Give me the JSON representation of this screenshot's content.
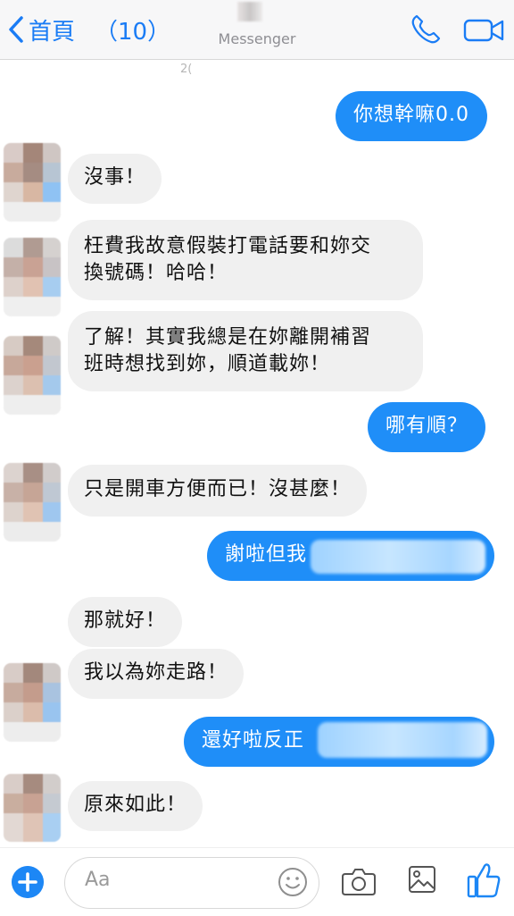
{
  "header": {
    "back_label": "首頁",
    "unread_count": "（10）",
    "title": "Messenger",
    "call_icon": "phone-icon",
    "video_icon": "video-camera-icon"
  },
  "timestamp": "2(",
  "messages": [
    {
      "side": "out",
      "text": "你想幹嘛0.0"
    },
    {
      "side": "in",
      "text": "沒事！"
    },
    {
      "side": "in",
      "line1": "枉費我故意假裝打電話要和妳交",
      "line2": "換號碼！哈哈！"
    },
    {
      "side": "in",
      "line1": "了解！其實我總是在妳離開補習",
      "line2": "班時想找到妳，順道載妳！"
    },
    {
      "side": "out",
      "text": "哪有順？"
    },
    {
      "side": "in",
      "text": "只是開車方便而已！沒甚麼！"
    },
    {
      "side": "out",
      "text": "謝啦但我"
    },
    {
      "side": "in",
      "text": "那就好！"
    },
    {
      "side": "in",
      "text": "我以為妳走路！"
    },
    {
      "side": "out",
      "text": "還好啦反正"
    },
    {
      "side": "in",
      "text": "原來如此！"
    }
  ],
  "composer": {
    "placeholder": "Aa",
    "icons": [
      "plus-icon",
      "emoji-icon",
      "camera-icon",
      "gallery-icon",
      "thumbs-up-icon"
    ]
  },
  "colors": {
    "accent": "#1f8ef8",
    "incoming_bubble": "#f0f0f0",
    "header_bg": "#f7f7f8"
  }
}
